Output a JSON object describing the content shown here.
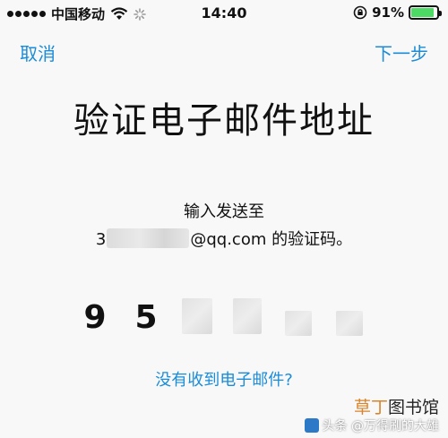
{
  "status_bar": {
    "carrier": "中国移动",
    "time": "14:40",
    "battery_percent": "91%",
    "battery_level": 0.91,
    "battery_color": "#4cd964",
    "icons": [
      "signal-dots-icon",
      "wifi-icon",
      "spinner-icon",
      "lock-rotate-icon",
      "battery-icon"
    ]
  },
  "nav": {
    "cancel_label": "取消",
    "next_label": "下一步",
    "accent_color": "#1a8cd8"
  },
  "main": {
    "title": "验证电子邮件地址",
    "desc_line1": "输入发送至",
    "email_prefix": "3",
    "email_suffix": "@qq.com 的验证码。",
    "code_digits": [
      "9",
      "5"
    ],
    "resend_link": "没有收到电子邮件?"
  },
  "watermark": {
    "site_part1": "草丁",
    "site_part2": "图书馆",
    "source": "头条 @万得刷的大雄"
  }
}
